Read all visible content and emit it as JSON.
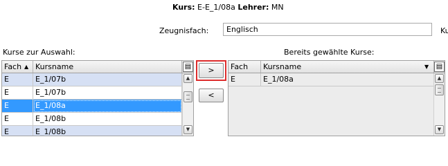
{
  "header": {
    "kurs_label": "Kurs:",
    "kurs_value": "E-E_1/08a",
    "lehrer_label": "Lehrer:",
    "lehrer_value": "MN"
  },
  "zeugnisfach": {
    "label": "Zeugnisfach:",
    "value": "Englisch",
    "cut_label": "Ku"
  },
  "available": {
    "title": "Kurse zur Auswahl:",
    "columns": [
      "Fach",
      "Kursname"
    ],
    "sort_indicator": "▲",
    "rows": [
      {
        "fach": "E",
        "kursname": "E_1/07b"
      },
      {
        "fach": "E",
        "kursname": "E_1/07b"
      },
      {
        "fach": "E",
        "kursname": "E_1/08a"
      },
      {
        "fach": "E",
        "kursname": "E_1/08b"
      },
      {
        "fach": "E",
        "kursname": "E_1/08b"
      }
    ],
    "selected_index": 2
  },
  "selected": {
    "title": "Bereits gewählte Kurse:",
    "columns": [
      "Fach",
      "Kursname"
    ],
    "sort_indicator": "▼",
    "rows": [
      {
        "fach": "E",
        "kursname": "E_1/08a"
      }
    ]
  },
  "buttons": {
    "add_label": ">",
    "remove_label": "<"
  },
  "icons": {
    "column_chooser": "column-chooser-icon",
    "scroll_up": "scroll-up-arrow-icon",
    "scroll_down": "scroll-down-arrow-icon"
  },
  "colors": {
    "row_alt": "#d6e0f4",
    "row_selected": "#3399ff",
    "highlight_frame": "#dd2b2b"
  }
}
